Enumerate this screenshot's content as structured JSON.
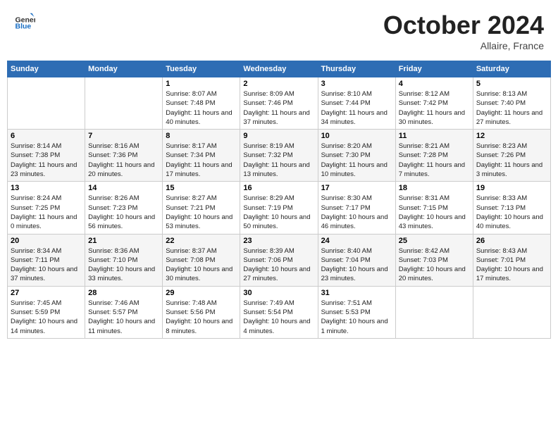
{
  "header": {
    "logo_general": "General",
    "logo_blue": "Blue",
    "title": "October 2024",
    "location": "Allaire, France"
  },
  "weekdays": [
    "Sunday",
    "Monday",
    "Tuesday",
    "Wednesday",
    "Thursday",
    "Friday",
    "Saturday"
  ],
  "weeks": [
    [
      null,
      null,
      {
        "day": "1",
        "sunrise": "Sunrise: 8:07 AM",
        "sunset": "Sunset: 7:48 PM",
        "daylight": "Daylight: 11 hours and 40 minutes."
      },
      {
        "day": "2",
        "sunrise": "Sunrise: 8:09 AM",
        "sunset": "Sunset: 7:46 PM",
        "daylight": "Daylight: 11 hours and 37 minutes."
      },
      {
        "day": "3",
        "sunrise": "Sunrise: 8:10 AM",
        "sunset": "Sunset: 7:44 PM",
        "daylight": "Daylight: 11 hours and 34 minutes."
      },
      {
        "day": "4",
        "sunrise": "Sunrise: 8:12 AM",
        "sunset": "Sunset: 7:42 PM",
        "daylight": "Daylight: 11 hours and 30 minutes."
      },
      {
        "day": "5",
        "sunrise": "Sunrise: 8:13 AM",
        "sunset": "Sunset: 7:40 PM",
        "daylight": "Daylight: 11 hours and 27 minutes."
      }
    ],
    [
      {
        "day": "6",
        "sunrise": "Sunrise: 8:14 AM",
        "sunset": "Sunset: 7:38 PM",
        "daylight": "Daylight: 11 hours and 23 minutes."
      },
      {
        "day": "7",
        "sunrise": "Sunrise: 8:16 AM",
        "sunset": "Sunset: 7:36 PM",
        "daylight": "Daylight: 11 hours and 20 minutes."
      },
      {
        "day": "8",
        "sunrise": "Sunrise: 8:17 AM",
        "sunset": "Sunset: 7:34 PM",
        "daylight": "Daylight: 11 hours and 17 minutes."
      },
      {
        "day": "9",
        "sunrise": "Sunrise: 8:19 AM",
        "sunset": "Sunset: 7:32 PM",
        "daylight": "Daylight: 11 hours and 13 minutes."
      },
      {
        "day": "10",
        "sunrise": "Sunrise: 8:20 AM",
        "sunset": "Sunset: 7:30 PM",
        "daylight": "Daylight: 11 hours and 10 minutes."
      },
      {
        "day": "11",
        "sunrise": "Sunrise: 8:21 AM",
        "sunset": "Sunset: 7:28 PM",
        "daylight": "Daylight: 11 hours and 7 minutes."
      },
      {
        "day": "12",
        "sunrise": "Sunrise: 8:23 AM",
        "sunset": "Sunset: 7:26 PM",
        "daylight": "Daylight: 11 hours and 3 minutes."
      }
    ],
    [
      {
        "day": "13",
        "sunrise": "Sunrise: 8:24 AM",
        "sunset": "Sunset: 7:25 PM",
        "daylight": "Daylight: 11 hours and 0 minutes."
      },
      {
        "day": "14",
        "sunrise": "Sunrise: 8:26 AM",
        "sunset": "Sunset: 7:23 PM",
        "daylight": "Daylight: 10 hours and 56 minutes."
      },
      {
        "day": "15",
        "sunrise": "Sunrise: 8:27 AM",
        "sunset": "Sunset: 7:21 PM",
        "daylight": "Daylight: 10 hours and 53 minutes."
      },
      {
        "day": "16",
        "sunrise": "Sunrise: 8:29 AM",
        "sunset": "Sunset: 7:19 PM",
        "daylight": "Daylight: 10 hours and 50 minutes."
      },
      {
        "day": "17",
        "sunrise": "Sunrise: 8:30 AM",
        "sunset": "Sunset: 7:17 PM",
        "daylight": "Daylight: 10 hours and 46 minutes."
      },
      {
        "day": "18",
        "sunrise": "Sunrise: 8:31 AM",
        "sunset": "Sunset: 7:15 PM",
        "daylight": "Daylight: 10 hours and 43 minutes."
      },
      {
        "day": "19",
        "sunrise": "Sunrise: 8:33 AM",
        "sunset": "Sunset: 7:13 PM",
        "daylight": "Daylight: 10 hours and 40 minutes."
      }
    ],
    [
      {
        "day": "20",
        "sunrise": "Sunrise: 8:34 AM",
        "sunset": "Sunset: 7:11 PM",
        "daylight": "Daylight: 10 hours and 37 minutes."
      },
      {
        "day": "21",
        "sunrise": "Sunrise: 8:36 AM",
        "sunset": "Sunset: 7:10 PM",
        "daylight": "Daylight: 10 hours and 33 minutes."
      },
      {
        "day": "22",
        "sunrise": "Sunrise: 8:37 AM",
        "sunset": "Sunset: 7:08 PM",
        "daylight": "Daylight: 10 hours and 30 minutes."
      },
      {
        "day": "23",
        "sunrise": "Sunrise: 8:39 AM",
        "sunset": "Sunset: 7:06 PM",
        "daylight": "Daylight: 10 hours and 27 minutes."
      },
      {
        "day": "24",
        "sunrise": "Sunrise: 8:40 AM",
        "sunset": "Sunset: 7:04 PM",
        "daylight": "Daylight: 10 hours and 23 minutes."
      },
      {
        "day": "25",
        "sunrise": "Sunrise: 8:42 AM",
        "sunset": "Sunset: 7:03 PM",
        "daylight": "Daylight: 10 hours and 20 minutes."
      },
      {
        "day": "26",
        "sunrise": "Sunrise: 8:43 AM",
        "sunset": "Sunset: 7:01 PM",
        "daylight": "Daylight: 10 hours and 17 minutes."
      }
    ],
    [
      {
        "day": "27",
        "sunrise": "Sunrise: 7:45 AM",
        "sunset": "Sunset: 5:59 PM",
        "daylight": "Daylight: 10 hours and 14 minutes."
      },
      {
        "day": "28",
        "sunrise": "Sunrise: 7:46 AM",
        "sunset": "Sunset: 5:57 PM",
        "daylight": "Daylight: 10 hours and 11 minutes."
      },
      {
        "day": "29",
        "sunrise": "Sunrise: 7:48 AM",
        "sunset": "Sunset: 5:56 PM",
        "daylight": "Daylight: 10 hours and 8 minutes."
      },
      {
        "day": "30",
        "sunrise": "Sunrise: 7:49 AM",
        "sunset": "Sunset: 5:54 PM",
        "daylight": "Daylight: 10 hours and 4 minutes."
      },
      {
        "day": "31",
        "sunrise": "Sunrise: 7:51 AM",
        "sunset": "Sunset: 5:53 PM",
        "daylight": "Daylight: 10 hours and 1 minute."
      },
      null,
      null
    ]
  ]
}
